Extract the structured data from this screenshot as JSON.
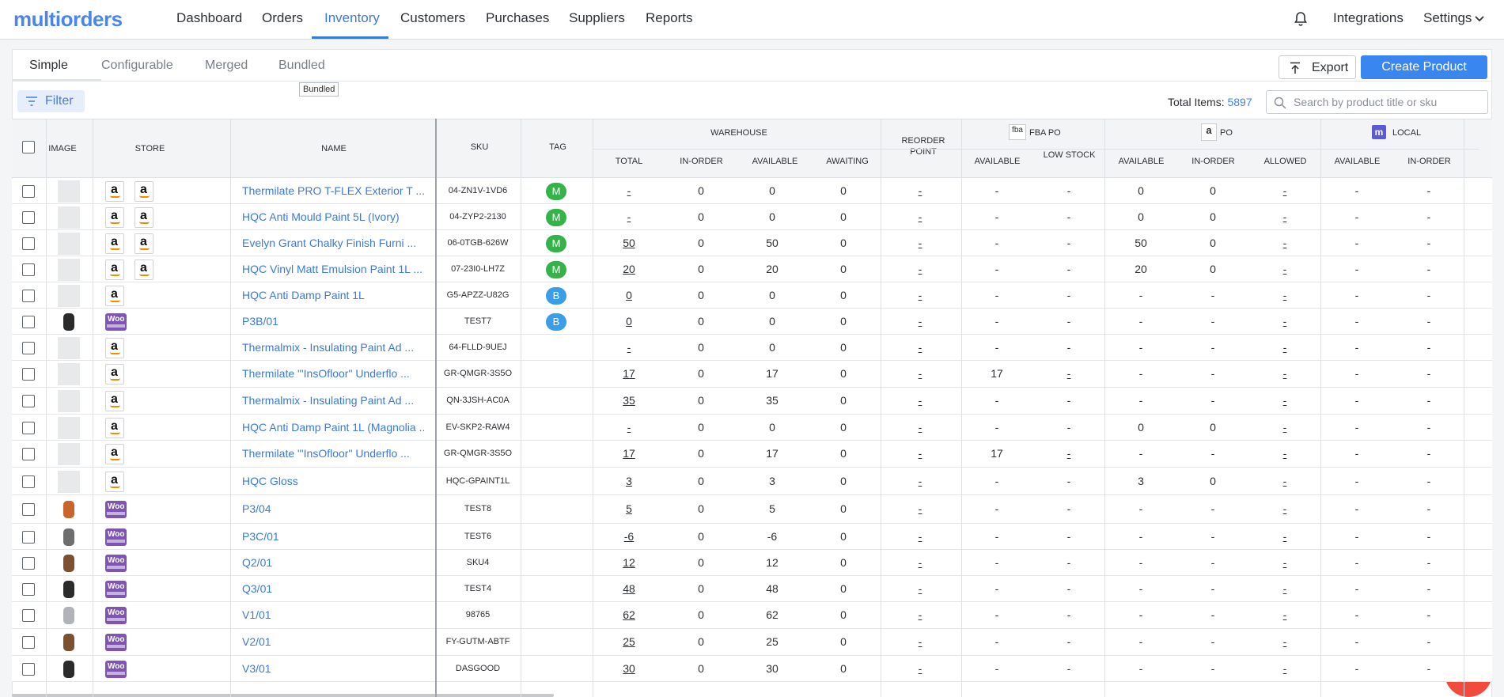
{
  "app": {
    "logo": "multiorders"
  },
  "nav": {
    "items": [
      "Dashboard",
      "Orders",
      "Inventory",
      "Customers",
      "Purchases",
      "Suppliers",
      "Reports"
    ],
    "active": "Inventory",
    "right": [
      "Integrations",
      "Settings"
    ]
  },
  "tabs": {
    "items": [
      "Simple",
      "Configurable",
      "Merged",
      "Bundled"
    ],
    "active": "Simple",
    "tooltip": "Bundled"
  },
  "toolbar": {
    "export": "Export",
    "create": "Create Product",
    "filter": "Filter",
    "total_label": "Total Items:",
    "total_value": "5897",
    "search_placeholder": "Search by product title or sku"
  },
  "table": {
    "headers": {
      "image": "IMAGE",
      "store": "STORE",
      "name": "NAME",
      "sku": "SKU",
      "tag": "TAG",
      "warehouse": "WAREHOUSE",
      "total": "TOTAL",
      "in_order": "IN-ORDER",
      "available": "AVAILABLE",
      "awaiting": "AWAITING",
      "reorder": "REORDER POINT",
      "fba_po": "FBA PO",
      "fba_logo": "fba",
      "fba_available": "AVAILABLE",
      "low_stock": "LOW STOCK",
      "po": "PO",
      "po_logo": "a",
      "po_available": "AVAILABLE",
      "po_in_order": "IN-ORDER",
      "po_allowed": "ALLOWED",
      "local": "LOCAL",
      "local_logo": "m",
      "local_available": "AVAILABLE",
      "local_in_order": "IN-ORDER"
    },
    "rows": [
      {
        "image": "none",
        "stores": [
          "amazon",
          "amazon"
        ],
        "name": "Thermilate PRO T-FLEX Exterior T ...",
        "sku": "04-ZN1V-1VD6",
        "tag": "M",
        "total": "-",
        "in_order": "0",
        "available": "0",
        "awaiting": "0",
        "reorder": "-",
        "fba_available": "-",
        "low_stock": "-",
        "po_available": "0",
        "po_in_order": "0",
        "po_allowed": "-",
        "local_available": "-",
        "local_in_order": "-"
      },
      {
        "image": "none",
        "stores": [
          "amazon",
          "amazon"
        ],
        "name": "HQC Anti Mould Paint 5L (Ivory)",
        "sku": "04-ZYP2-2130",
        "tag": "M",
        "total": "-",
        "in_order": "0",
        "available": "0",
        "awaiting": "0",
        "reorder": "-",
        "fba_available": "-",
        "low_stock": "-",
        "po_available": "0",
        "po_in_order": "0",
        "po_allowed": "-",
        "local_available": "-",
        "local_in_order": "-"
      },
      {
        "image": "none",
        "stores": [
          "amazon",
          "amazon"
        ],
        "name": "Evelyn Grant Chalky Finish Furni ...",
        "sku": "06-0TGB-626W",
        "tag": "M",
        "total": "50",
        "in_order": "0",
        "available": "50",
        "awaiting": "0",
        "reorder": "-",
        "fba_available": "-",
        "low_stock": "-",
        "po_available": "50",
        "po_in_order": "0",
        "po_allowed": "-",
        "local_available": "-",
        "local_in_order": "-"
      },
      {
        "image": "none",
        "stores": [
          "amazon",
          "amazon"
        ],
        "name": "HQC Vinyl Matt Emulsion Paint 1L ...",
        "sku": "07-23I0-LH7Z",
        "tag": "M",
        "total": "20",
        "in_order": "0",
        "available": "20",
        "awaiting": "0",
        "reorder": "-",
        "fba_available": "-",
        "low_stock": "-",
        "po_available": "20",
        "po_in_order": "0",
        "po_allowed": "-",
        "local_available": "-",
        "local_in_order": "-"
      },
      {
        "image": "none",
        "stores": [
          "amazon"
        ],
        "name": "HQC Anti Damp Paint 1L",
        "sku": "G5-APZZ-U82G",
        "tag": "B",
        "total": "0",
        "in_order": "0",
        "available": "0",
        "awaiting": "0",
        "reorder": "-",
        "fba_available": "-",
        "low_stock": "-",
        "po_available": "-",
        "po_in_order": "-",
        "po_allowed": "-",
        "local_available": "-",
        "local_in_order": "-"
      },
      {
        "image": "watch-black",
        "stores": [
          "woocommerce"
        ],
        "name": "P3B/01",
        "sku": "TEST7",
        "tag": "B",
        "total": "0",
        "in_order": "0",
        "available": "0",
        "awaiting": "0",
        "reorder": "-",
        "fba_available": "-",
        "low_stock": "-",
        "po_available": "-",
        "po_in_order": "-",
        "po_allowed": "-",
        "local_available": "-",
        "local_in_order": "-"
      },
      {
        "image": "none",
        "stores": [
          "amazon"
        ],
        "name": "Thermalmix - Insulating Paint Ad ...",
        "sku": "64-FLLD-9UEJ",
        "tag": "",
        "total": "-",
        "in_order": "0",
        "available": "0",
        "awaiting": "0",
        "reorder": "-",
        "fba_available": "-",
        "low_stock": "-",
        "po_available": "-",
        "po_in_order": "-",
        "po_allowed": "-",
        "local_available": "-",
        "local_in_order": "-"
      },
      {
        "image": "none",
        "stores": [
          "amazon"
        ],
        "name": "Thermilate \"'InsOfloor\" Underflo ...",
        "sku": "GR-QMGR-3S5O",
        "tag": "",
        "total": "17",
        "in_order": "0",
        "available": "17",
        "awaiting": "0",
        "reorder": "-",
        "fba_available": "17",
        "low_stock": "-",
        "po_available": "-",
        "po_in_order": "-",
        "po_allowed": "-",
        "local_available": "-",
        "local_in_order": "-"
      },
      {
        "image": "none",
        "stores": [
          "amazon"
        ],
        "name": "Thermalmix - Insulating Paint Ad ...",
        "sku": "QN-3JSH-AC0A",
        "tag": "",
        "total": "35",
        "in_order": "0",
        "available": "35",
        "awaiting": "0",
        "reorder": "-",
        "fba_available": "-",
        "low_stock": "-",
        "po_available": "-",
        "po_in_order": "-",
        "po_allowed": "-",
        "local_available": "-",
        "local_in_order": "-"
      },
      {
        "image": "none",
        "stores": [
          "amazon"
        ],
        "name": "HQC Anti Damp Paint 1L (Magnolia ...",
        "sku": "EV-SKP2-RAW4",
        "tag": "",
        "total": "-",
        "in_order": "0",
        "available": "0",
        "awaiting": "0",
        "reorder": "-",
        "fba_available": "-",
        "low_stock": "-",
        "po_available": "0",
        "po_in_order": "0",
        "po_allowed": "-",
        "local_available": "-",
        "local_in_order": "-"
      },
      {
        "image": "none",
        "stores": [
          "amazon"
        ],
        "name": "Thermilate \"'InsOfloor\" Underflo ...",
        "sku": "GR-QMGR-3S5O",
        "tag": "",
        "total": "17",
        "in_order": "0",
        "available": "17",
        "awaiting": "0",
        "reorder": "-",
        "fba_available": "17",
        "low_stock": "-",
        "po_available": "-",
        "po_in_order": "-",
        "po_allowed": "-",
        "local_available": "-",
        "local_in_order": "-"
      },
      {
        "image": "none",
        "stores": [
          "amazon"
        ],
        "name": "HQC Gloss",
        "sku": "HQC-GPAINT1L",
        "tag": "",
        "total": "3",
        "in_order": "0",
        "available": "3",
        "awaiting": "0",
        "reorder": "-",
        "fba_available": "-",
        "low_stock": "-",
        "po_available": "3",
        "po_in_order": "0",
        "po_allowed": "-",
        "local_available": "-",
        "local_in_order": "-"
      },
      {
        "image": "watch-orange",
        "stores": [
          "woocommerce"
        ],
        "name": "P3/04",
        "sku": "TEST8",
        "tag": "",
        "total": "5",
        "in_order": "0",
        "available": "5",
        "awaiting": "0",
        "reorder": "-",
        "fba_available": "-",
        "low_stock": "-",
        "po_available": "-",
        "po_in_order": "-",
        "po_allowed": "-",
        "local_available": "-",
        "local_in_order": "-"
      },
      {
        "image": "watch-grey",
        "stores": [
          "woocommerce"
        ],
        "name": "P3C/01",
        "sku": "TEST6",
        "tag": "",
        "total": "-6",
        "in_order": "0",
        "available": "-6",
        "awaiting": "0",
        "reorder": "-",
        "fba_available": "-",
        "low_stock": "-",
        "po_available": "-",
        "po_in_order": "-",
        "po_allowed": "-",
        "local_available": "-",
        "local_in_order": "-"
      },
      {
        "image": "watch-brown",
        "stores": [
          "woocommerce"
        ],
        "name": "Q2/01",
        "sku": "SKU4",
        "tag": "",
        "total": "12",
        "in_order": "0",
        "available": "12",
        "awaiting": "0",
        "reorder": "-",
        "fba_available": "-",
        "low_stock": "-",
        "po_available": "-",
        "po_in_order": "-",
        "po_allowed": "-",
        "local_available": "-",
        "local_in_order": "-"
      },
      {
        "image": "watch-black",
        "stores": [
          "woocommerce"
        ],
        "name": "Q3/01",
        "sku": "TEST4",
        "tag": "",
        "total": "48",
        "in_order": "0",
        "available": "48",
        "awaiting": "0",
        "reorder": "-",
        "fba_available": "-",
        "low_stock": "-",
        "po_available": "-",
        "po_in_order": "-",
        "po_allowed": "-",
        "local_available": "-",
        "local_in_order": "-"
      },
      {
        "image": "watch-silver",
        "stores": [
          "woocommerce"
        ],
        "name": "V1/01",
        "sku": "98765",
        "tag": "",
        "total": "62",
        "in_order": "0",
        "available": "62",
        "awaiting": "0",
        "reorder": "-",
        "fba_available": "-",
        "low_stock": "-",
        "po_available": "-",
        "po_in_order": "-",
        "po_allowed": "-",
        "local_available": "-",
        "local_in_order": "-"
      },
      {
        "image": "watch-brown",
        "stores": [
          "woocommerce"
        ],
        "name": "V2/01",
        "sku": "FY-GUTM-ABTF",
        "tag": "",
        "total": "25",
        "in_order": "0",
        "available": "25",
        "awaiting": "0",
        "reorder": "-",
        "fba_available": "-",
        "low_stock": "-",
        "po_available": "-",
        "po_in_order": "-",
        "po_allowed": "-",
        "local_available": "-",
        "local_in_order": "-"
      },
      {
        "image": "watch-black",
        "stores": [
          "woocommerce"
        ],
        "name": "V3/01",
        "sku": "DASGOOD",
        "tag": "",
        "total": "30",
        "in_order": "0",
        "available": "30",
        "awaiting": "0",
        "reorder": "-",
        "fba_available": "-",
        "low_stock": "-",
        "po_available": "-",
        "po_in_order": "-",
        "po_allowed": "-",
        "local_available": "-",
        "local_in_order": "-"
      }
    ]
  },
  "colors": {
    "brand": "#4a86e8",
    "primary": "#3a86f0",
    "tag_m": "#35b34a",
    "tag_b": "#3a9de8",
    "woo": "#7f54b3",
    "chat": "#f24a3d"
  }
}
